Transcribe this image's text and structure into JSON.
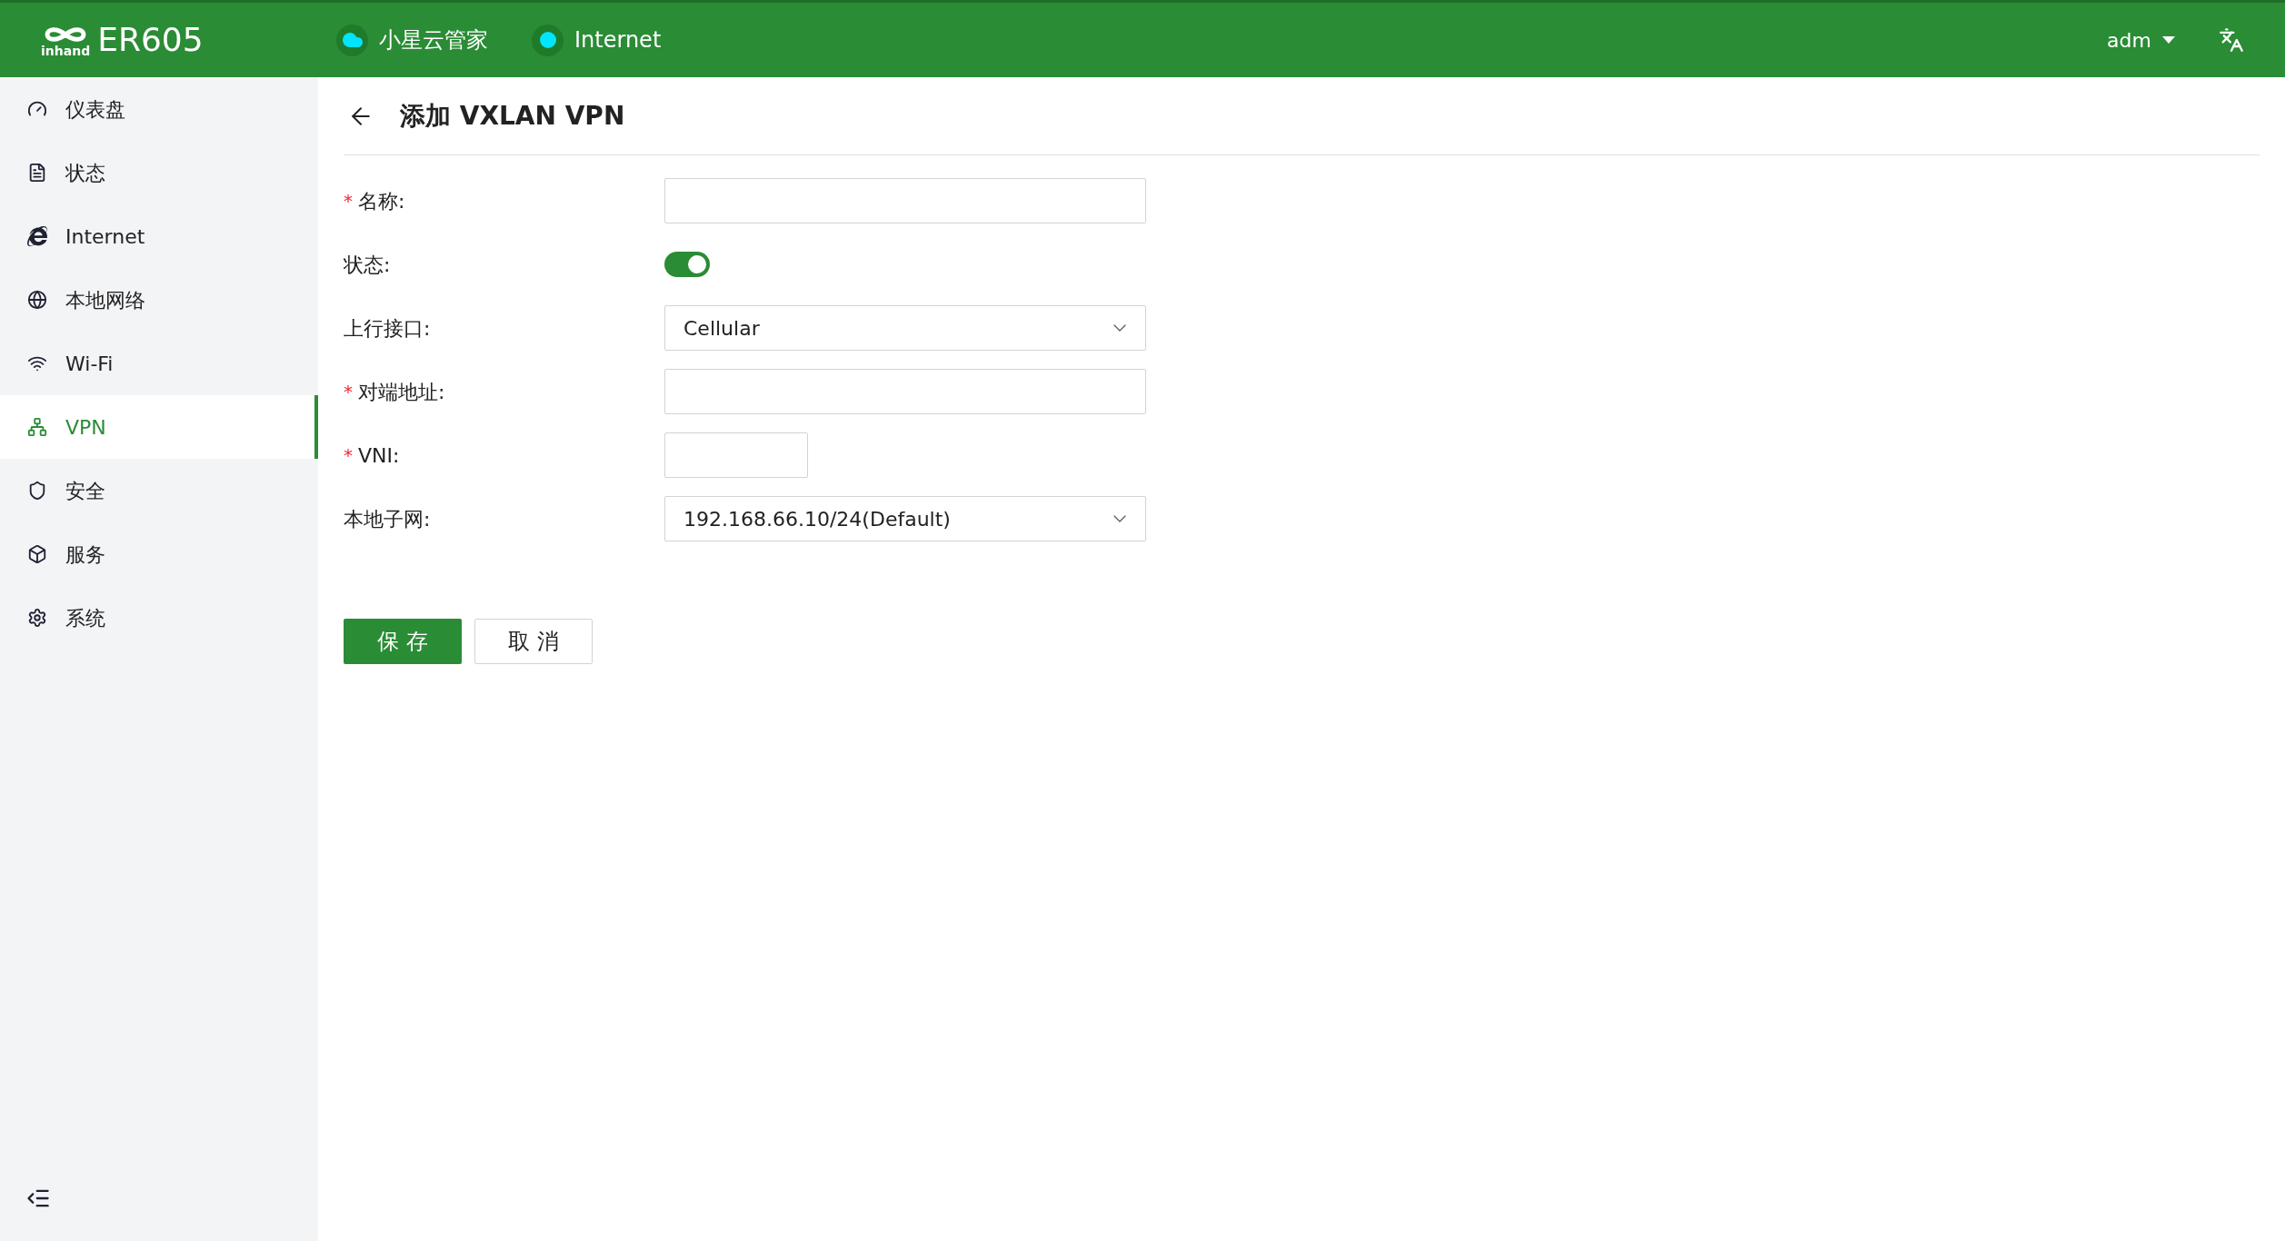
{
  "header": {
    "logo_text": "inhand",
    "product": "ER605",
    "status_items": [
      {
        "kind": "cloud",
        "label": "小星云管家",
        "color": "#00e5ff"
      },
      {
        "kind": "dot",
        "label": "Internet",
        "color": "#00e5ff"
      }
    ],
    "user": "adm"
  },
  "sidebar": {
    "items": [
      {
        "label": "仪表盘",
        "selected": false
      },
      {
        "label": "状态",
        "selected": false
      },
      {
        "label": "Internet",
        "selected": false
      },
      {
        "label": "本地网络",
        "selected": false
      },
      {
        "label": "Wi-Fi",
        "selected": false
      },
      {
        "label": "VPN",
        "selected": true
      },
      {
        "label": "安全",
        "selected": false
      },
      {
        "label": "服务",
        "selected": false
      },
      {
        "label": "系统",
        "selected": false
      }
    ]
  },
  "page": {
    "title": "添加 VXLAN VPN"
  },
  "form": {
    "fields": [
      {
        "kind": "text",
        "label": "名称:",
        "required_mark": "*"
      },
      {
        "kind": "switch",
        "label": "状态:",
        "on": true
      },
      {
        "kind": "select",
        "label": "上行接口:",
        "value": "Cellular"
      },
      {
        "kind": "text",
        "label": "对端地址:",
        "required_mark": "*"
      },
      {
        "kind": "number",
        "label": "VNI:",
        "required_mark": "*"
      },
      {
        "kind": "select",
        "label": "本地子网:",
        "value": "192.168.66.10/24(Default)"
      }
    ],
    "buttons": [
      {
        "kind": "primary",
        "label": "保 存"
      },
      {
        "kind": "default",
        "label": "取 消"
      }
    ]
  }
}
